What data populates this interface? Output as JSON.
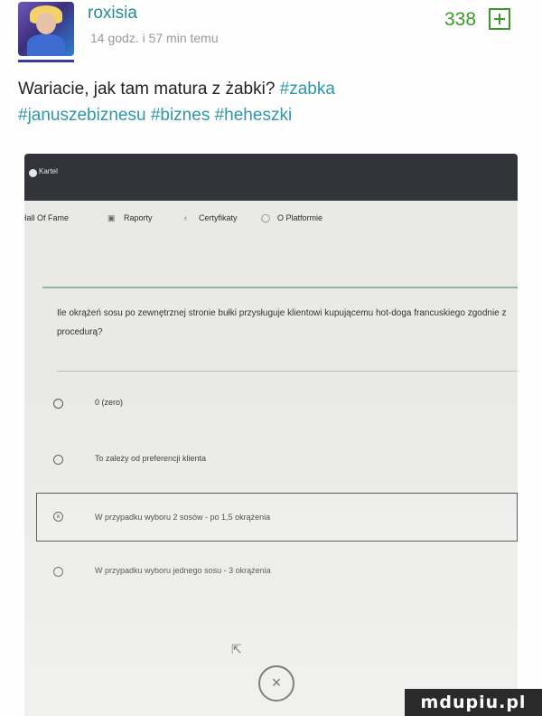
{
  "post": {
    "username": "roxisia",
    "time": "14 godz. i 57 min temu",
    "score": "338",
    "text_plain": "Wariacie, jak tam matura z żabki? ",
    "tags": [
      "#zabka",
      "#januszebiznesu",
      "#biznes",
      "#heheszki"
    ]
  },
  "screenshot": {
    "logo_text": "Kartel",
    "nav": [
      "Hall Of Fame",
      "Raporty",
      "Certyfikaty",
      "O Platformie"
    ],
    "question": "Ile okrążeń sosu po zewnętrznej stronie bułki przysługuje klientowi kupującemu hot-doga francuskiego zgodnie z procedurą?",
    "options": [
      {
        "label": "0 (zero)",
        "selected": false
      },
      {
        "label": "To zależy od preferencji klienta",
        "selected": false
      },
      {
        "label": "W przypadku wyboru 2 sosów - po 1,5 okrążenia",
        "selected": true
      },
      {
        "label": "W przypadku wyboru jednego sosu - 3 okrążenia",
        "selected": false
      }
    ],
    "close_symbol": "×"
  },
  "watermark": "mdupiu.pl"
}
